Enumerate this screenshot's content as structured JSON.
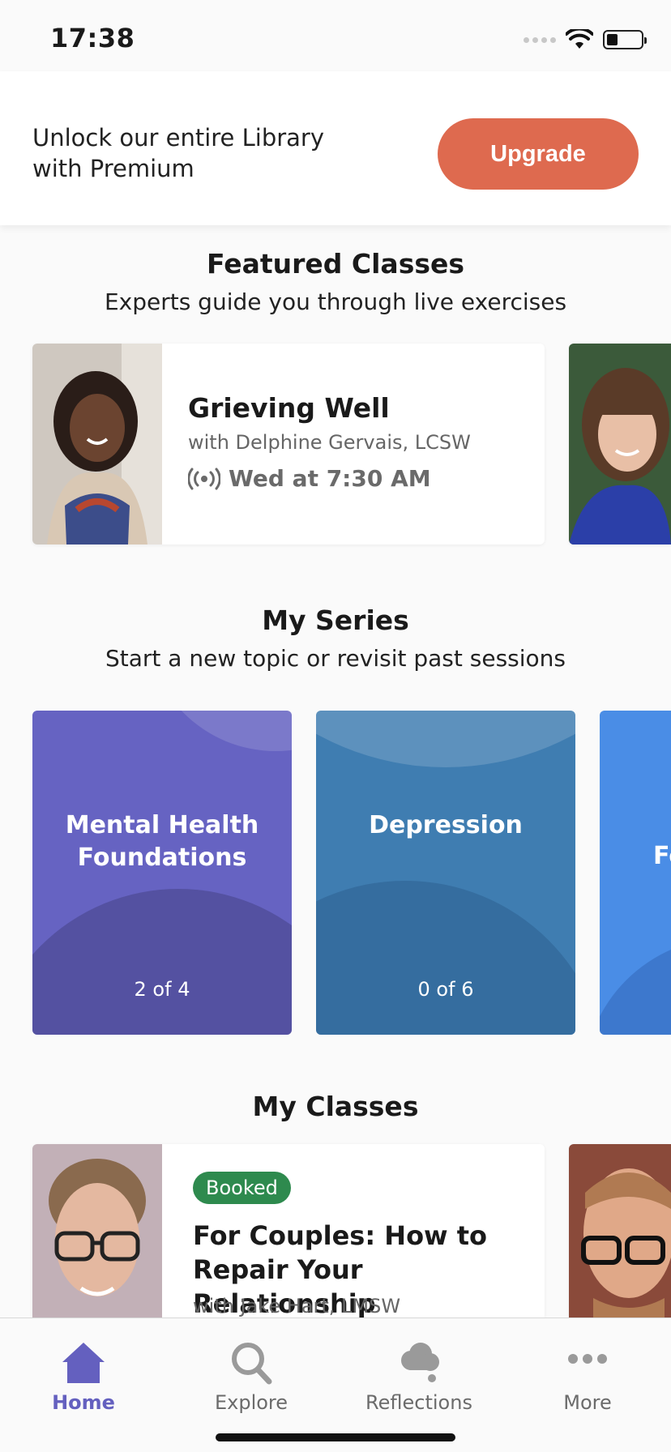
{
  "status": {
    "time": "17:38"
  },
  "banner": {
    "text": "Unlock our entire Library with Premium",
    "button": "Upgrade",
    "button_color": "#de6a4f"
  },
  "featured": {
    "title": "Featured Classes",
    "subtitle": "Experts guide you through live exercises",
    "cards": [
      {
        "title": "Grieving Well",
        "instructor": "with Delphine Gervais, LCSW",
        "time": "Wed at 7:30 AM",
        "icon": "live-broadcast-icon"
      }
    ]
  },
  "series": {
    "title": "My Series",
    "subtitle": "Start a new topic or revisit past sessions",
    "items": [
      {
        "title": "Mental Health Foundations",
        "progress": "2 of 4",
        "color": "#6663c2"
      },
      {
        "title": "Depression",
        "progress": "0 of 6",
        "color": "#3f7db1"
      },
      {
        "title": "Fo",
        "progress": "",
        "color": "#4a8de6"
      }
    ]
  },
  "my_classes": {
    "title": "My Classes",
    "cards": [
      {
        "badge": "Booked",
        "title": "For Couples: How to Repair Your Relationship",
        "instructor": "with Jake Hart, LMSW"
      }
    ]
  },
  "tabs": [
    {
      "label": "Home",
      "icon": "home-icon",
      "active": true
    },
    {
      "label": "Explore",
      "icon": "search-icon",
      "active": false
    },
    {
      "label": "Reflections",
      "icon": "thought-cloud-icon",
      "active": false
    },
    {
      "label": "More",
      "icon": "more-dots-icon",
      "active": false
    }
  ],
  "colors": {
    "accent": "#6460bf",
    "badge": "#2e8a4e"
  }
}
